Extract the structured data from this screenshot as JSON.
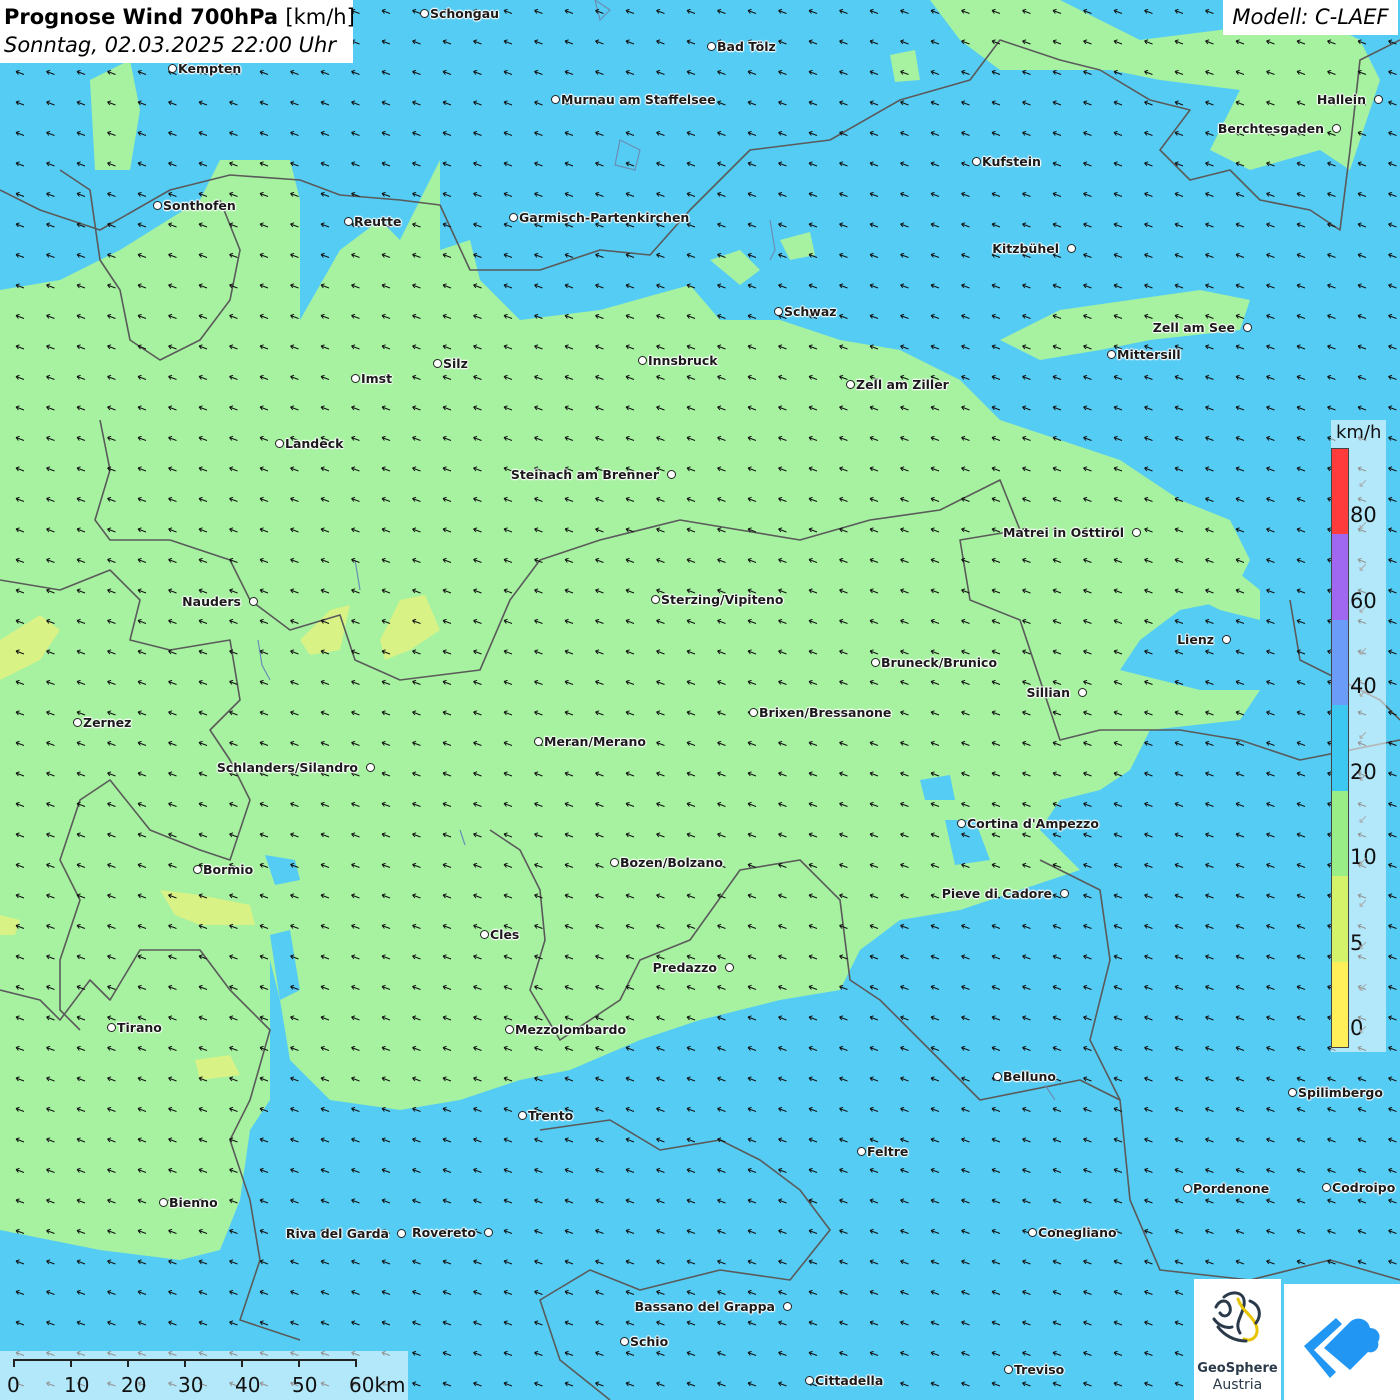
{
  "title": {
    "main": "Prognose Wind 700hPa",
    "unit": "[km/h]",
    "datetime": "Sonntag, 02.03.2025 22:00 Uhr"
  },
  "model": "Modell: C-LAEF",
  "colors": {
    "background_20_40": "#55ccf4",
    "band_10_20": "#a6f2a0",
    "band_5_10": "#d8f285",
    "band_0_5": "#fff85e"
  },
  "legend": {
    "unit": "km/h",
    "segments": [
      {
        "color": "#ff3b3b",
        "from": 80,
        "to": 100
      },
      {
        "color": "#a068f0",
        "from": 60,
        "to": 80
      },
      {
        "color": "#6b9cf7",
        "from": 40,
        "to": 60
      },
      {
        "color": "#3cc8f0",
        "from": 20,
        "to": 40
      },
      {
        "color": "#99ee88",
        "from": 10,
        "to": 20
      },
      {
        "color": "#d4f26a",
        "from": 5,
        "to": 10
      },
      {
        "color": "#fff05a",
        "from": 0,
        "to": 5
      }
    ],
    "labels": [
      "80",
      "60",
      "40",
      "20",
      "10",
      "5",
      "0"
    ]
  },
  "scale": {
    "labels": [
      "0",
      "10",
      "20",
      "30",
      "40",
      "50",
      "60km"
    ]
  },
  "wind": {
    "direction": "from south-east",
    "arrow_symbol": "➘"
  },
  "cities": [
    {
      "name": "Schongau",
      "side": "right"
    },
    {
      "name": "Bad Tölz",
      "side": "right"
    },
    {
      "name": "Kempten",
      "side": "right"
    },
    {
      "name": "Murnau am Staffelsee",
      "side": "right"
    },
    {
      "name": "Hallein",
      "side": "left"
    },
    {
      "name": "Berchtesgaden",
      "side": "left"
    },
    {
      "name": "Kufstein",
      "side": "right"
    },
    {
      "name": "Sonthofen",
      "side": "right"
    },
    {
      "name": "Reutte",
      "side": "right"
    },
    {
      "name": "Garmisch-Partenkirchen",
      "side": "right"
    },
    {
      "name": "Kitzbühel",
      "side": "left"
    },
    {
      "name": "Schwaz",
      "side": "right"
    },
    {
      "name": "Zell am See",
      "side": "left"
    },
    {
      "name": "Mittersill",
      "side": "right"
    },
    {
      "name": "Innsbruck",
      "side": "right"
    },
    {
      "name": "Silz",
      "side": "right"
    },
    {
      "name": "Imst",
      "side": "right"
    },
    {
      "name": "Zell am Ziller",
      "side": "right"
    },
    {
      "name": "Landeck",
      "side": "right"
    },
    {
      "name": "Steinach am Brenner",
      "side": "left"
    },
    {
      "name": "Matrei in Osttirol",
      "side": "left"
    },
    {
      "name": "Nauders",
      "side": "left"
    },
    {
      "name": "Sterzing/Vipiteno",
      "side": "right"
    },
    {
      "name": "Lienz",
      "side": "left"
    },
    {
      "name": "Bruneck/Brunico",
      "side": "right"
    },
    {
      "name": "Sillian",
      "side": "left"
    },
    {
      "name": "Brixen/Bressanone",
      "side": "right"
    },
    {
      "name": "Zernez",
      "side": "right"
    },
    {
      "name": "Meran/Merano",
      "side": "right"
    },
    {
      "name": "Schlanders/Silandro",
      "side": "left"
    },
    {
      "name": "Cortina d'Ampezzo",
      "side": "right"
    },
    {
      "name": "Bozen/Bolzano",
      "side": "right"
    },
    {
      "name": "Bormio",
      "side": "right"
    },
    {
      "name": "Pieve di Cadore",
      "side": "left"
    },
    {
      "name": "Cles",
      "side": "right"
    },
    {
      "name": "Predazzo",
      "side": "left"
    },
    {
      "name": "Tirano",
      "side": "right"
    },
    {
      "name": "Mezzolombardo",
      "side": "right"
    },
    {
      "name": "Belluno",
      "side": "right"
    },
    {
      "name": "Spilimbergo",
      "side": "right"
    },
    {
      "name": "Trento",
      "side": "right"
    },
    {
      "name": "Feltre",
      "side": "right"
    },
    {
      "name": "Pordenone",
      "side": "right"
    },
    {
      "name": "Codroipo",
      "side": "right"
    },
    {
      "name": "Bienno",
      "side": "right"
    },
    {
      "name": "Riva del Garda",
      "side": "left"
    },
    {
      "name": "Rovereto",
      "side": "left"
    },
    {
      "name": "Conegliano",
      "side": "right"
    },
    {
      "name": "Bassano del Grappa",
      "side": "left"
    },
    {
      "name": "Schio",
      "side": "right"
    },
    {
      "name": "Treviso",
      "side": "right"
    },
    {
      "name": "Cittadella",
      "side": "right"
    }
  ],
  "logos": {
    "geosphere_line1": "GeoSphere",
    "geosphere_line2": "Austria"
  }
}
